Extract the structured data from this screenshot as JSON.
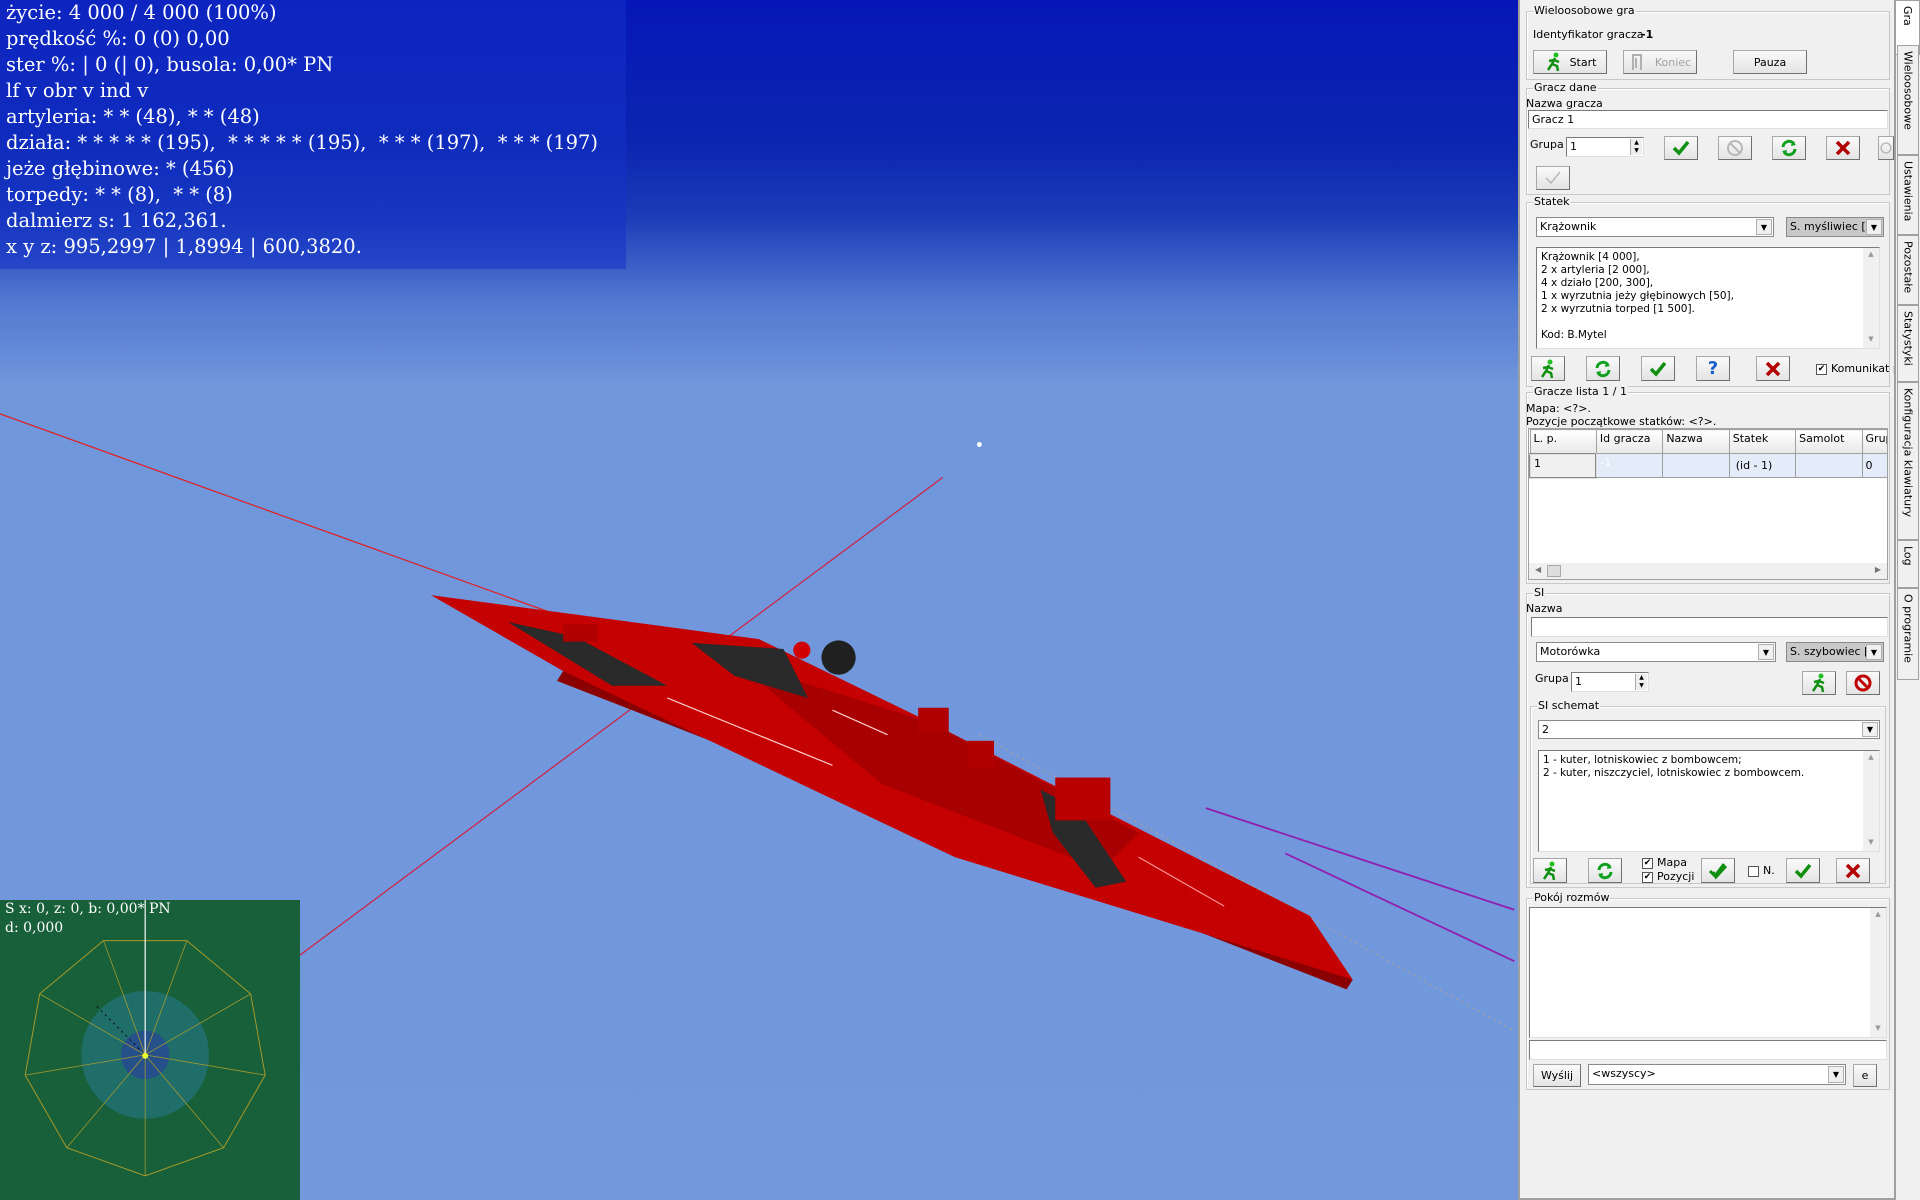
{
  "hud": {
    "lines": [
      "życie: 4 000 / 4 000 (100%)",
      "prędkość %: 0 (0) 0,00",
      "ster %: | 0 (| 0), busola: 0,00* PN",
      "lf v obr v ind v",
      "artyleria: * * (48),  * * (48)",
      "działa: * * * * * (195),  * * * * * (195),  * * * (197),  * * * (197)",
      "jeże głębinowe: * (456)",
      "torpedy: * * (8),  * * (8)",
      "dalmierz s: 1 162,361.",
      "x y z: 995,2997 | 1,8994 | 600,3820."
    ]
  },
  "minimap": {
    "line1": "S x: 0, z: 0, b: 0,00* PN",
    "line2": "d: 0,000"
  },
  "colors": {
    "ship": "#c40000",
    "sky_top": "#0616b8",
    "sea": "#7398dc",
    "minimap_bg": "#17603a"
  },
  "tabs": [
    "Gra",
    "Wieloosobowe",
    "Ustawienia",
    "Pozostałe",
    "Statystyki",
    "Konfiguracja klawiatury",
    "Log",
    "O programie"
  ],
  "multiplayer": {
    "legend": "Wieloosobowe gra",
    "id_label": "Identyfikator gracza",
    "id_value": "-1",
    "start": "Start",
    "end": "Koniec",
    "pause": "Pauza"
  },
  "player": {
    "legend": "Gracz dane",
    "name_label": "Nazwa gracza",
    "name_value": "Gracz 1",
    "group_label": "Grupa",
    "group_value": "1"
  },
  "ship": {
    "legend": "Statek",
    "ship_select": "Krążownik",
    "plane_select": "S. myśliwiec [sa",
    "description": "Krążownik [4 000],\n2 x artyleria [2 000],\n4 x działo [200, 300],\n1 x wyrzutnia jeży głębinowych [50],\n2 x wyrzutnia torped [1 500].\n\nKod: B.Mytel",
    "message_checkbox": "Komunikat po",
    "message_checked": true
  },
  "players_list": {
    "legend": "Gracze lista 1 / 1",
    "map": "Mapa: <?>.",
    "positions": "Pozycje początkowe statków: <?>.",
    "columns": [
      "L. p.",
      "Id gracza",
      "Nazwa",
      "Statek",
      "Samolot",
      "Grupa"
    ],
    "rows": [
      [
        "1",
        "-1",
        "",
        "(id -  1)",
        "",
        "0"
      ]
    ]
  },
  "ai": {
    "legend": "SI",
    "name_label": "Nazwa",
    "name_value": "",
    "ship_select": "Motorówka",
    "plane_select": "S. szybowiec [sa",
    "group_label": "Grupa",
    "group_value": "1",
    "scheme": {
      "legend": "SI schemat",
      "select": "2",
      "description": "1 - kuter, lotniskowiec z bombowcem;\n2 - kuter, niszczyciel, lotniskowiec z bombowcem.",
      "map_checkbox": "Mapa",
      "map_checked": true,
      "pos_checkbox": "Pozycji",
      "pos_checked": true,
      "n_checkbox": "N.",
      "n_checked": false
    }
  },
  "chat": {
    "legend": "Pokój rozmów",
    "input": "",
    "send": "Wyślij",
    "recipient": "<wszyscy>",
    "e_button": "e"
  }
}
